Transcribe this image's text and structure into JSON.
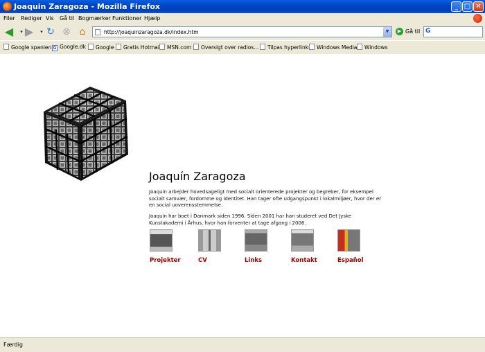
{
  "window": {
    "title": "Joaquin Zaragoza - Mozilla Firefox"
  },
  "menu": [
    "Filer",
    "Rediger",
    "Vis",
    "Gå til",
    "Bogmærker",
    "Funktioner",
    "Hjælp"
  ],
  "nav": {
    "url": "http://joaquinzaragoza.dk/index.htm",
    "go_label": "Gå til"
  },
  "bookmarks": [
    "Google spanien",
    "Google.dk",
    "Google",
    "Gratis Hotmail",
    "MSN.com",
    "Oversigt over radios...",
    "Tilpas hyperlinks",
    "Windows Media",
    "Windows"
  ],
  "page": {
    "name": "Joaquín Zaragoza",
    "para1": "Joaquin arbejder hovedsageligt med socialt orienterede projekter og begreber, for eksempel socialt samvær, fordomme og identitet. Han tager ofte udgangspunkt i lokalmiljøer, hvor der er en social uoverensstemmelse.",
    "para2": "Joaquin har boet i Danmark siden 1996. Siden 2001 har han studeret ved Det Jyske Kunstakademi i Århus, hvor han forventer at tage afgang i 2006.",
    "links": [
      {
        "label": "Projekter"
      },
      {
        "label": "CV"
      },
      {
        "label": "Links"
      },
      {
        "label": "Kontakt"
      },
      {
        "label": "Español"
      }
    ]
  },
  "status": {
    "text": "Færdig"
  },
  "colors": {
    "link": "#a00000",
    "titlebar": "#0046c8"
  }
}
